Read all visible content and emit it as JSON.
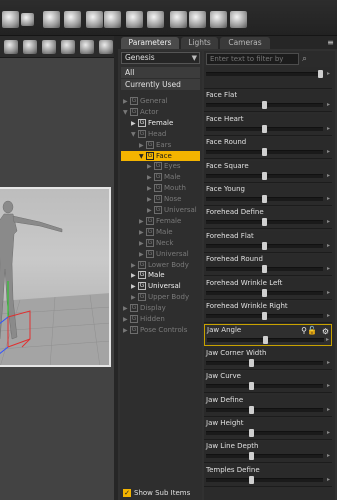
{
  "panel": {
    "tabs": [
      {
        "label": "Parameters",
        "active": true
      },
      {
        "label": "Lights",
        "active": false
      },
      {
        "label": "Cameras",
        "active": false
      }
    ],
    "figure_selector": "Genesis",
    "categories": {
      "all": "All",
      "currently_used": "Currently Used"
    },
    "filter_placeholder": "Enter text to filter by",
    "show_sub_items": "Show Sub Items"
  },
  "tree": [
    {
      "label": "General",
      "depth": 0,
      "expanded": false,
      "state": "dim"
    },
    {
      "label": "Actor",
      "depth": 0,
      "expanded": true,
      "state": "dim"
    },
    {
      "label": "Female",
      "depth": 1,
      "expanded": false,
      "state": "bright"
    },
    {
      "label": "Head",
      "depth": 1,
      "expanded": true,
      "state": "dim"
    },
    {
      "label": "Ears",
      "depth": 2,
      "expanded": false,
      "state": "dim"
    },
    {
      "label": "Face",
      "depth": 2,
      "expanded": true,
      "state": "selected"
    },
    {
      "label": "Eyes",
      "depth": 3,
      "expanded": false,
      "state": "dim"
    },
    {
      "label": "Male",
      "depth": 3,
      "expanded": false,
      "state": "dim"
    },
    {
      "label": "Mouth",
      "depth": 3,
      "expanded": false,
      "state": "dim"
    },
    {
      "label": "Nose",
      "depth": 3,
      "expanded": false,
      "state": "dim"
    },
    {
      "label": "Universal",
      "depth": 3,
      "expanded": false,
      "state": "dim"
    },
    {
      "label": "Female",
      "depth": 2,
      "expanded": false,
      "state": "dim"
    },
    {
      "label": "Male",
      "depth": 2,
      "expanded": false,
      "state": "dim"
    },
    {
      "label": "Neck",
      "depth": 2,
      "expanded": false,
      "state": "dim"
    },
    {
      "label": "Universal",
      "depth": 2,
      "expanded": false,
      "state": "dim"
    },
    {
      "label": "Lower Body",
      "depth": 1,
      "expanded": false,
      "state": "dim"
    },
    {
      "label": "Male",
      "depth": 1,
      "expanded": false,
      "state": "bright"
    },
    {
      "label": "Universal",
      "depth": 1,
      "expanded": false,
      "state": "bright"
    },
    {
      "label": "Upper Body",
      "depth": 1,
      "expanded": false,
      "state": "dim"
    },
    {
      "label": "Display",
      "depth": 0,
      "expanded": false,
      "state": "dim"
    },
    {
      "label": "Hidden",
      "depth": 0,
      "expanded": false,
      "state": "dim"
    },
    {
      "label": "Pose Controls",
      "depth": 0,
      "expanded": false,
      "state": "dim"
    }
  ],
  "properties": [
    {
      "label": "",
      "value": 1.0
    },
    {
      "label": "Face Flat",
      "value": 0.5
    },
    {
      "label": "Face Heart",
      "value": 0.5
    },
    {
      "label": "Face Round",
      "value": 0.5
    },
    {
      "label": "Face Square",
      "value": 0.5
    },
    {
      "label": "Face Young",
      "value": 0.5
    },
    {
      "label": "Forehead Define",
      "value": 0.5
    },
    {
      "label": "Forehead Flat",
      "value": 0.5
    },
    {
      "label": "Forehead Round",
      "value": 0.5
    },
    {
      "label": "Forehead Wrinkle Left",
      "value": 0.5
    },
    {
      "label": "Forehead Wrinkle Right",
      "value": 0.5
    },
    {
      "label": "Jaw Angle",
      "value": 0.5,
      "selected": true
    },
    {
      "label": "Jaw Corner Width",
      "value": 0.38
    },
    {
      "label": "Jaw Curve",
      "value": 0.38
    },
    {
      "label": "Jaw Define",
      "value": 0.38
    },
    {
      "label": "Jaw Height",
      "value": 0.38
    },
    {
      "label": "Jaw Line Depth",
      "value": 0.38
    },
    {
      "label": "Temples Define",
      "value": 0.38
    }
  ],
  "colors": {
    "accent": "#f4b400",
    "panel_bg": "#2b2b2b",
    "track": "#1a1a1a"
  },
  "icons": {
    "toolbar": [
      "scene-icon",
      "render-icon",
      "tools-icon",
      "tools2-icon",
      "surface-icon",
      "joint-icon",
      "morph-icon",
      "content-icon",
      "camera-icon",
      "settings-icon",
      "render-camera-icon",
      "aux-icon"
    ],
    "viewport": [
      "orbit-icon",
      "pan-icon",
      "zoom-icon",
      "rotate-icon",
      "frame-icon",
      "perspective-icon"
    ]
  }
}
